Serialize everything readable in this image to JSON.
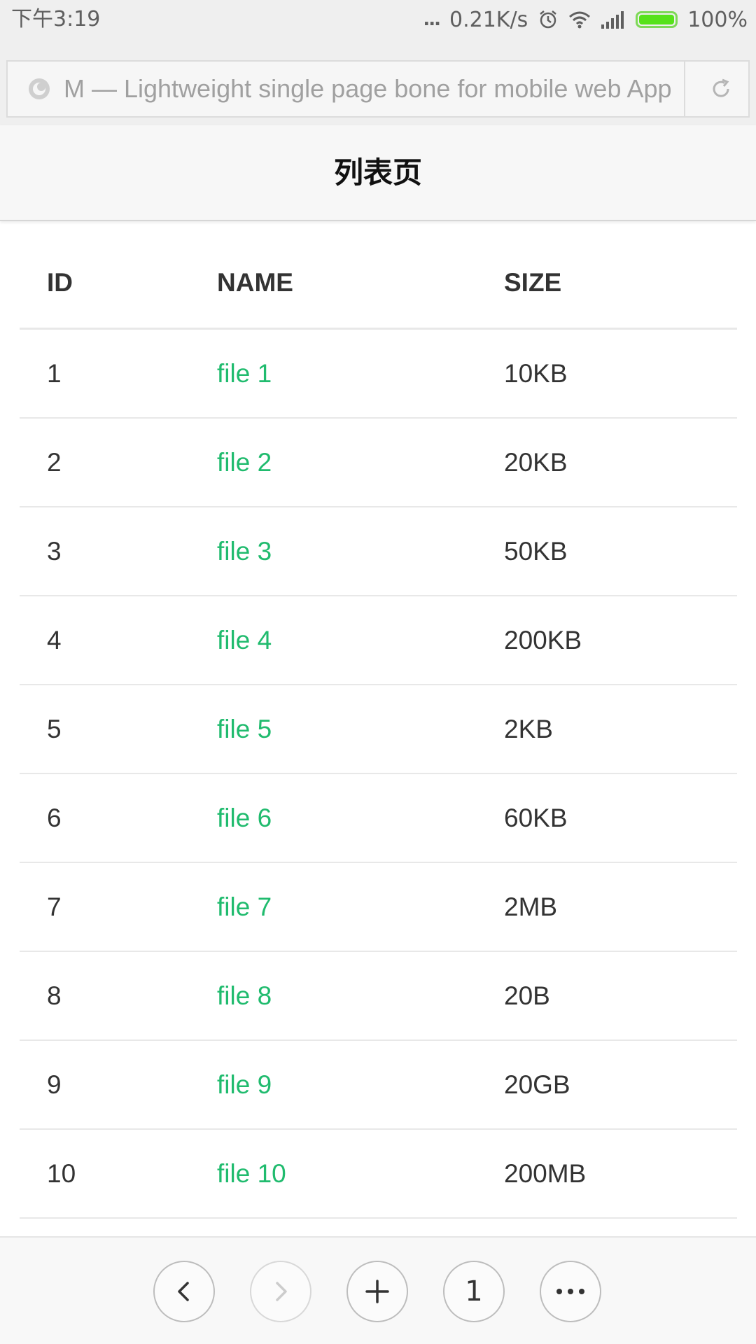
{
  "status_bar": {
    "time": "下午3:19",
    "dots": "...",
    "network_speed": "0.21K/s",
    "battery_percent": "100%",
    "battery_level": 1.0,
    "icons": [
      "alarm-icon",
      "wifi-icon",
      "signal-icon",
      "battery-icon"
    ],
    "battery_color": "#56e21a"
  },
  "browser": {
    "address_text": "M — Lightweight single page bone for mobile web App",
    "site_icon": "site-icon",
    "reload_icon": "reload-icon"
  },
  "page": {
    "title": "列表页"
  },
  "table": {
    "headers": {
      "id": "ID",
      "name": "NAME",
      "size": "SIZE"
    },
    "rows": [
      {
        "id": "1",
        "name": "file 1",
        "size": "10KB"
      },
      {
        "id": "2",
        "name": "file 2",
        "size": "20KB"
      },
      {
        "id": "3",
        "name": "file 3",
        "size": "50KB"
      },
      {
        "id": "4",
        "name": "file 4",
        "size": "200KB"
      },
      {
        "id": "5",
        "name": "file 5",
        "size": "2KB"
      },
      {
        "id": "6",
        "name": "file 6",
        "size": "60KB"
      },
      {
        "id": "7",
        "name": "file 7",
        "size": "2MB"
      },
      {
        "id": "8",
        "name": "file 8",
        "size": "20B"
      },
      {
        "id": "9",
        "name": "file 9",
        "size": "20GB"
      },
      {
        "id": "10",
        "name": "file 10",
        "size": "200MB"
      }
    ],
    "link_color": "#20bb6e"
  },
  "toolbar": {
    "tab_count": "1",
    "buttons": [
      "back-icon",
      "forward-icon",
      "plus-icon",
      "tabs-button",
      "more-icon"
    ]
  }
}
